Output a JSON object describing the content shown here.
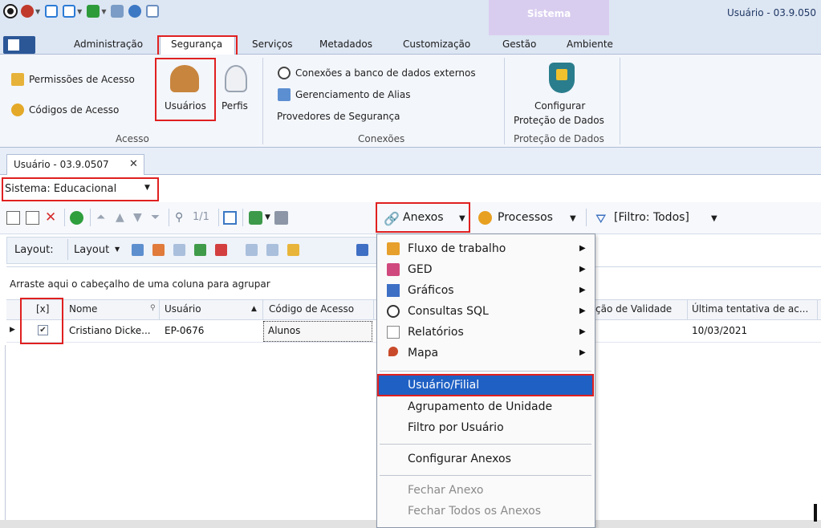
{
  "window": {
    "title": "Usuário - 03.9.050",
    "context_tab": "Sistema"
  },
  "ribbon": {
    "tabs": [
      "Administração",
      "Segurança",
      "Serviços",
      "Metadados",
      "Customização",
      "Gestão",
      "Ambiente"
    ],
    "groups": {
      "acesso": {
        "label": "Acesso",
        "permissoes": "Permissões de Acesso",
        "codigos": "Códigos de Acesso",
        "usuarios": "Usuários",
        "perfis": "Perfis"
      },
      "conexoes": {
        "label": "Conexões",
        "externos": "Conexões a banco de dados externos",
        "alias": "Gerenciamento de Alias",
        "provedores": "Provedores de Segurança"
      },
      "protecao": {
        "label": "Proteção de Dados",
        "configurar_l1": "Configurar",
        "configurar_l2": "Proteção de Dados"
      }
    }
  },
  "document_tab": {
    "label": "Usuário - 03.9.0507",
    "close": "✕"
  },
  "system_selector": {
    "text": "Sistema:  Educacional"
  },
  "toolbar": {
    "page": "1/1",
    "anexos": "Anexos",
    "processos": "Processos",
    "filtro": "[Filtro: Todos]"
  },
  "toolbar2": {
    "layout_label": "Layout:",
    "layout_button": "Layout"
  },
  "grid": {
    "group_hint": "Arraste aqui o cabeçalho de uma coluna para agrupar",
    "columns": [
      "[x]",
      "Nome",
      "Usuário",
      "Código de Acesso",
      "ção de Validade",
      "Última tentativa de ac..."
    ],
    "row": {
      "checked": "✔",
      "nome": "Cristiano Dicke...",
      "usuario": "EP-0676",
      "codigo": "Alunos",
      "ultima": "10/03/2021"
    }
  },
  "menu": {
    "items": [
      {
        "label": "Fluxo de trabalho",
        "submenu": true
      },
      {
        "label": "GED",
        "submenu": true
      },
      {
        "label": "Gráficos",
        "submenu": true
      },
      {
        "label": "Consultas SQL",
        "submenu": true
      },
      {
        "label": "Relatórios",
        "submenu": true
      },
      {
        "label": "Mapa",
        "submenu": true
      }
    ],
    "selected": "Usuário/Filial",
    "extra": [
      "Agrupamento de Unidade",
      "Filtro por Usuário"
    ],
    "configurar": "Configurar Anexos",
    "fechar": "Fechar Anexo",
    "fechar_todos": "Fechar Todos os Anexos"
  },
  "colors": {
    "highlight": "#e02020",
    "selection": "#1f60c4",
    "ribbon_bg": "#dde6f3"
  }
}
